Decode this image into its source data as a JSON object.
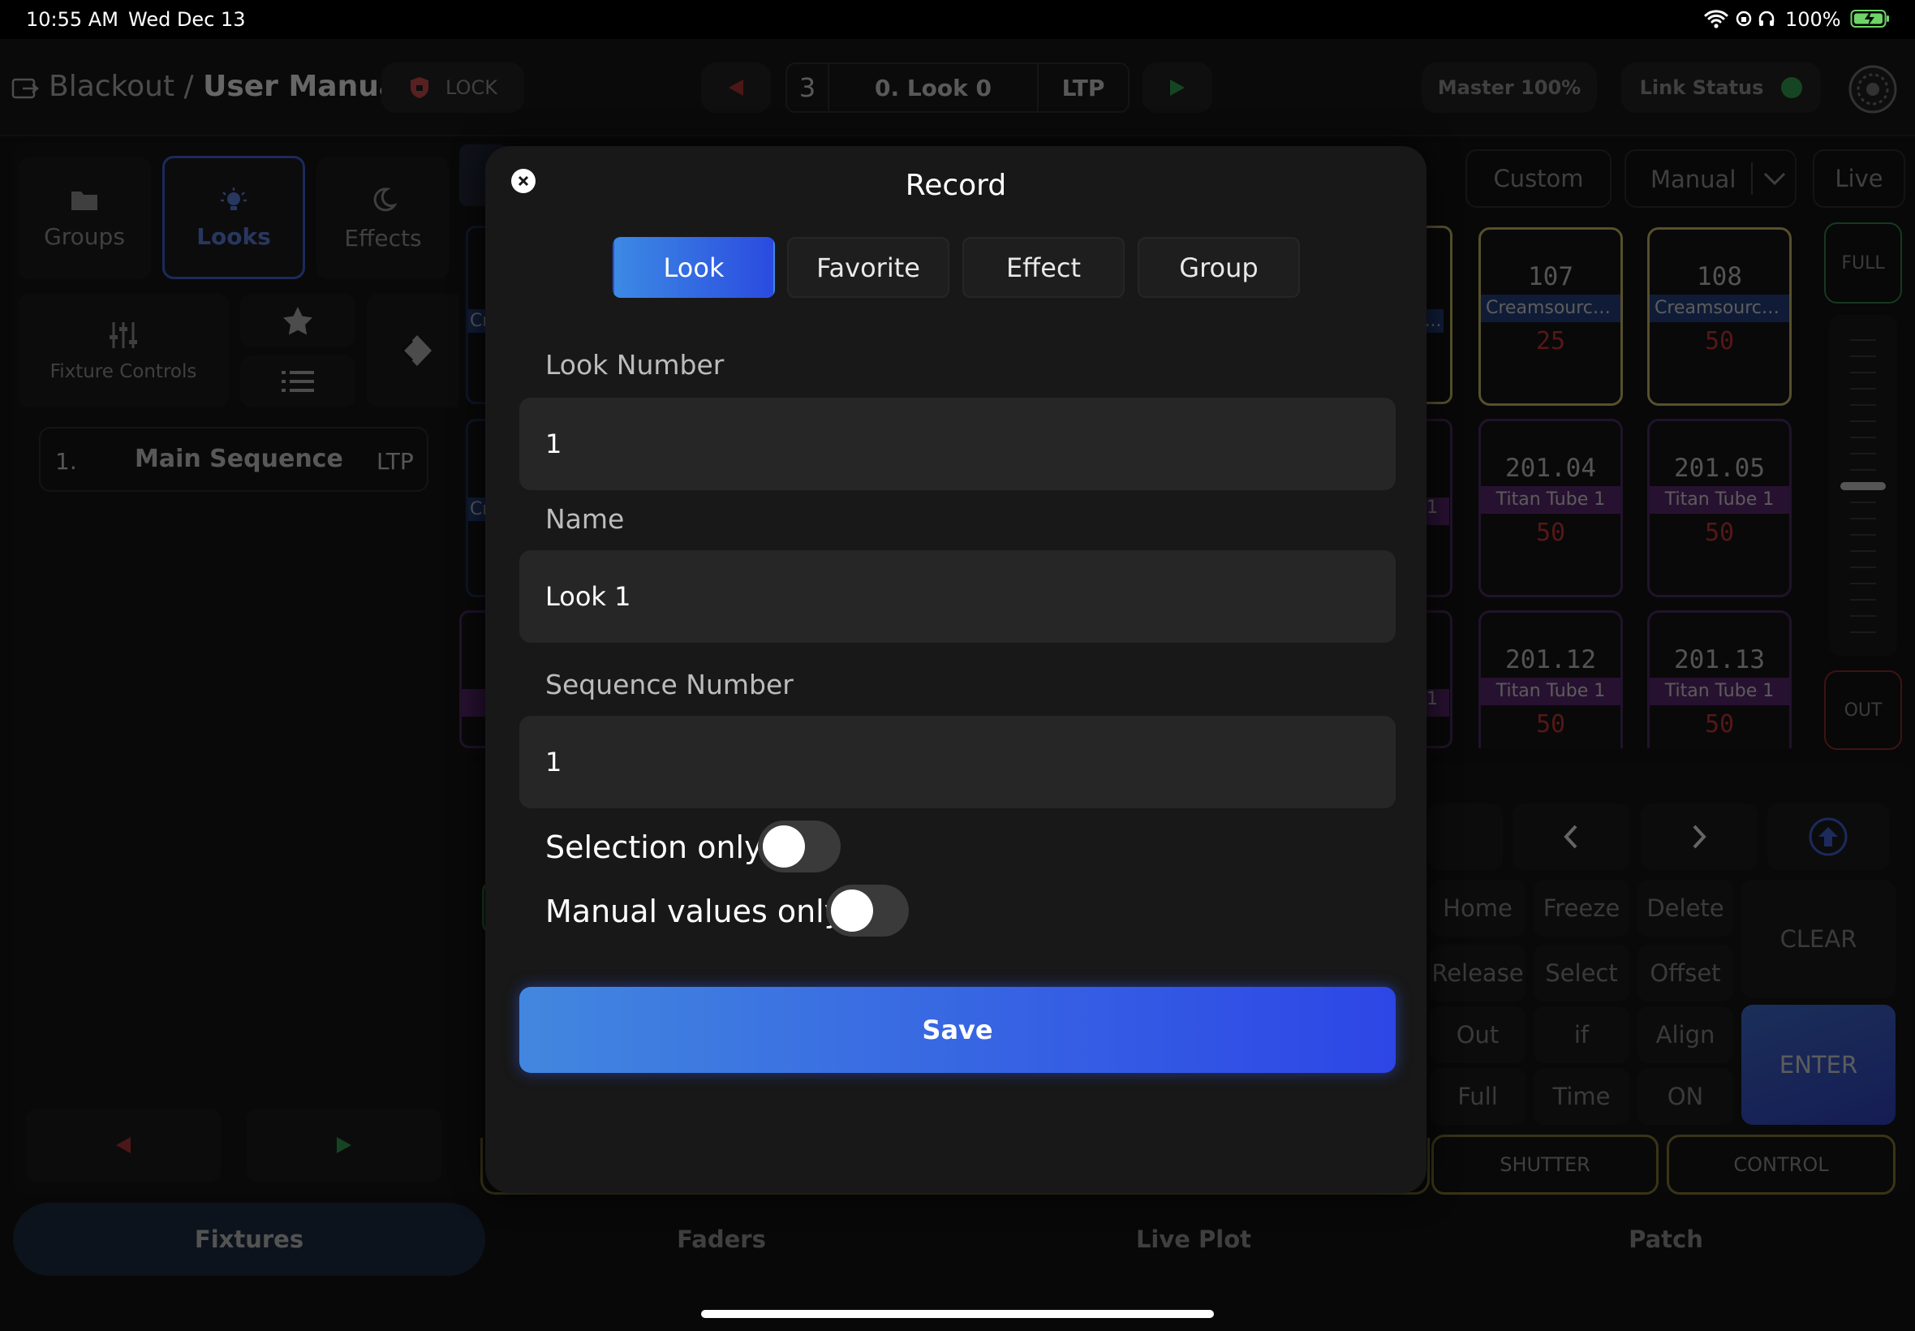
{
  "status": {
    "time": "10:55 AM",
    "date": "Wed Dec 13",
    "battery": "100%"
  },
  "header": {
    "breadcrumb_parent": "Blackout",
    "breadcrumb_separator": " / ",
    "title": "User Manual",
    "lock_label": "LOCK",
    "cue_number": "3",
    "cue_name": "0. Look 0",
    "cue_mode": "LTP",
    "master": "Master 100%",
    "link_status": "Link Status",
    "link_color": "#2fa84f"
  },
  "left_panel": {
    "groups": "Groups",
    "looks": "Looks",
    "effects": "Effects",
    "fixture_controls": "Fixture Controls",
    "sequence": {
      "number": "1.",
      "name": "Main Sequence",
      "mode": "LTP"
    }
  },
  "view_controls": {
    "custom": "Custom",
    "manual": "Manual",
    "live": "Live"
  },
  "fader": {
    "full": "FULL",
    "out": "OUT"
  },
  "fixtures": [
    {
      "number": "107",
      "tag": "Creamsource...",
      "value": "25",
      "tag_color": "#1f3d86",
      "border": "#d6c66a"
    },
    {
      "number": "108",
      "tag": "Creamsource...",
      "value": "50",
      "tag_color": "#1f3d86",
      "border": "#d6c66a"
    },
    {
      "number": "201.04",
      "tag": "Titan Tube 1",
      "value": "50",
      "tag_color": "#5b2173",
      "border": "#4a2766"
    },
    {
      "number": "201.05",
      "tag": "Titan Tube 1",
      "value": "50",
      "tag_color": "#5b2173",
      "border": "#4a2766"
    },
    {
      "number": "201.12",
      "tag": "Titan Tube 1",
      "value": "50",
      "tag_color": "#5b2173",
      "border": "#4a2766"
    },
    {
      "number": "201.13",
      "tag": "Titan Tube 1",
      "value": "50",
      "tag_color": "#5b2173",
      "border": "#4a2766"
    }
  ],
  "partial": {
    "cr1": "Cr",
    "cr2": "Cr",
    "e_tag": "e...",
    "one_a": "1",
    "one_b": "1",
    "t_tag": "T"
  },
  "keypad": {
    "home": "Home",
    "freeze": "Freeze",
    "delete": "Delete",
    "release": "Release",
    "select": "Select",
    "offset": "Offset",
    "out": "Out",
    "if": "if",
    "align": "Align",
    "full": "Full",
    "time": "Time",
    "on": "ON",
    "clear": "CLEAR",
    "enter": "ENTER"
  },
  "attribute_buttons": {
    "shutter": "SHUTTER",
    "control": "CONTROL"
  },
  "bottom_tabs": {
    "fixtures": "Fixtures",
    "faders": "Faders",
    "live_plot": "Live Plot",
    "patch": "Patch"
  },
  "record_dialog": {
    "title": "Record",
    "tabs": [
      "Look",
      "Favorite",
      "Effect",
      "Group"
    ],
    "active_tab": "Look",
    "look_number_label": "Look Number",
    "look_number_value": "1",
    "name_label": "Name",
    "name_value": "Look 1",
    "sequence_number_label": "Sequence Number",
    "sequence_number_value": "1",
    "selection_only_label": "Selection only",
    "manual_values_only_label": "Manual values only",
    "save_label": "Save"
  }
}
